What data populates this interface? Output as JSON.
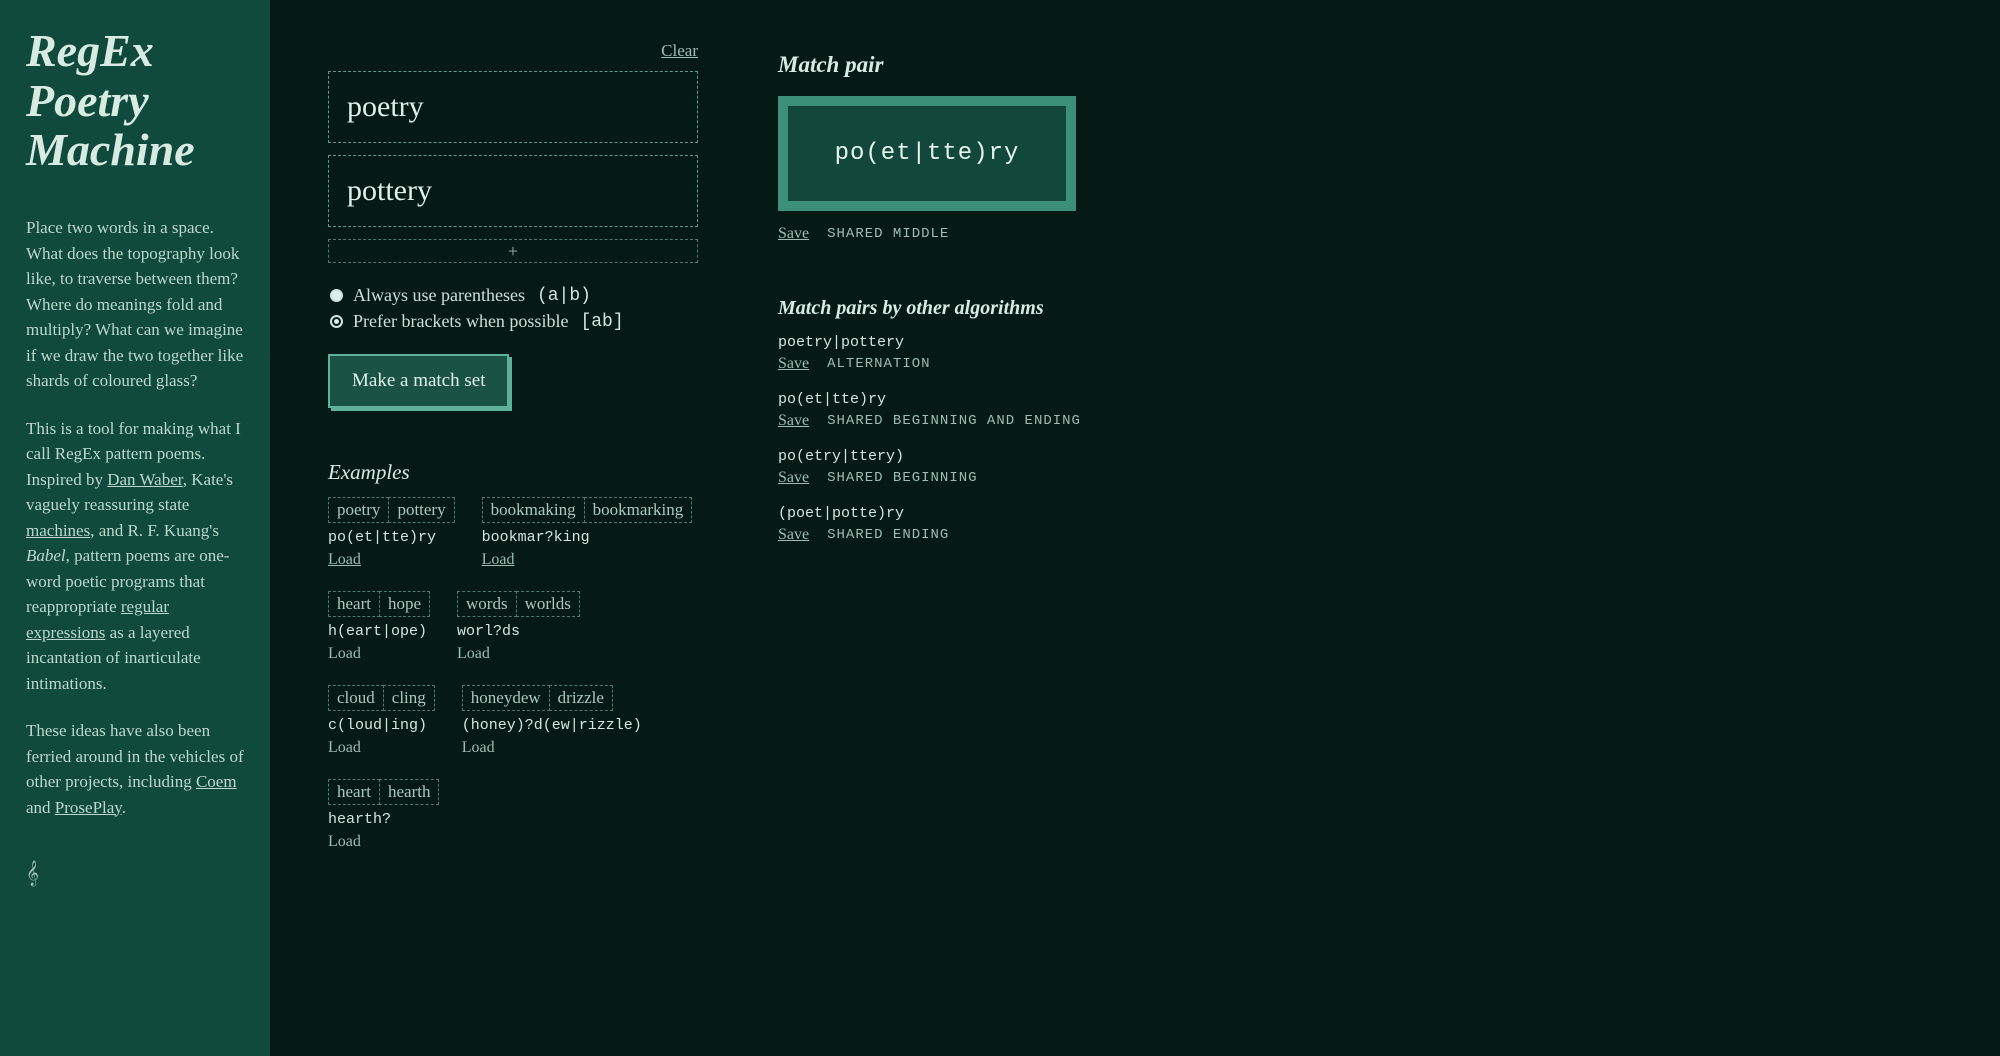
{
  "sidebar": {
    "title_line1": "RegEx",
    "title_line2": "Poetry",
    "title_line3": "Machine",
    "para1": "Place two words in a space. What does the topography look like, to traverse between them? Where do meanings fold and multiply? What can we imagine if we draw the two together like shards of coloured glass?",
    "para2_a": "This is a tool for making what I call RegEx pattern poems. Inspired by ",
    "link_dan": "Dan Waber",
    "para2_b": ", Kate's vaguely reassuring state ",
    "link_machines": "machines",
    "para2_c": ", and R. F. Kuang's ",
    "em_babel": "Babel",
    "para2_d": ", pattern poems are one-word poetic programs that reappropriate ",
    "link_regex": "regular expressions",
    "para2_e": " as a layered incantation of inarticulate intimations.",
    "para3_a": "These ideas have also been ferried around in the vehicles of other projects, including ",
    "link_coem": "Coem",
    "para3_b": " and ",
    "link_proseplay": "ProsePlay",
    "para3_c": "."
  },
  "editor": {
    "clear_label": "Clear",
    "word1": "poetry",
    "word2": "pottery",
    "add_label": "+",
    "radio_paren_label": "Always use parentheses",
    "radio_paren_suffix": "(a|b)",
    "radio_bracket_label": "Prefer brackets when possible",
    "radio_bracket_suffix": "[ab]",
    "button_label": "Make a match set"
  },
  "examples_heading": "Examples",
  "examples": [
    {
      "words": [
        "poetry",
        "pottery"
      ],
      "pattern": "po(et|tte)ry",
      "load": "Load",
      "underline": true
    },
    {
      "words": [
        "bookmaking",
        "bookmarking"
      ],
      "pattern": "bookmar?king",
      "load": "Load",
      "underline": true
    },
    {
      "words": [
        "heart",
        "hope"
      ],
      "pattern": "h(eart|ope)",
      "load": "Load",
      "underline": false
    },
    {
      "words": [
        "words",
        "worlds"
      ],
      "pattern": "worl?ds",
      "load": "Load",
      "underline": false
    },
    {
      "words": [
        "cloud",
        "cling"
      ],
      "pattern": "c(loud|ing)",
      "load": "Load",
      "underline": false
    },
    {
      "words": [
        "honeydew",
        "drizzle"
      ],
      "pattern": "(honey)?d(ew|rizzle)",
      "load": "Load",
      "underline": false
    },
    {
      "words": [
        "heart",
        "hearth"
      ],
      "pattern": "hearth?",
      "load": "Load",
      "underline": false
    }
  ],
  "match": {
    "heading": "Match pair",
    "pattern": "po(et|tte)ry",
    "save_label": "Save",
    "algo_label": "SHARED MIDDLE"
  },
  "others_heading": "Match pairs by other algorithms",
  "others": [
    {
      "pattern": "poetry|pottery",
      "save": "Save",
      "algo": "ALTERNATION"
    },
    {
      "pattern": "po(et|tte)ry",
      "save": "Save",
      "algo": "SHARED BEGINNING AND ENDING"
    },
    {
      "pattern": "po(etry|ttery)",
      "save": "Save",
      "algo": "SHARED BEGINNING"
    },
    {
      "pattern": "(poet|potte)ry",
      "save": "Save",
      "algo": "SHARED ENDING"
    }
  ]
}
